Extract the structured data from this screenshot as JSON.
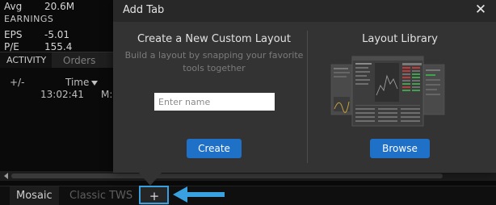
{
  "background": {
    "stats": [
      {
        "key": "Avg",
        "value": "20.6M"
      },
      {
        "key": "EPS",
        "value": "-5.01"
      },
      {
        "key": "P/E",
        "value": "155.4"
      }
    ],
    "stats_sub": "EARNINGS",
    "tabs": {
      "active": "ACTIVITY",
      "orders": "Orders"
    },
    "table": {
      "col_change": "+/-",
      "col_time": "Time",
      "row_time": "13:02:41",
      "row_extra": "M:"
    }
  },
  "bottom_tabs": {
    "mosaic": "Mosaic",
    "classic": "Classic TWS",
    "add": "+"
  },
  "dialog": {
    "title": "Add Tab",
    "close_glyph": "✕",
    "create": {
      "title": "Create a New Custom Layout",
      "description": "Build a layout by snapping your favorite tools together",
      "input_placeholder": "Enter name",
      "button_label": "Create"
    },
    "library": {
      "title": "Layout Library",
      "button_label": "Browse"
    }
  },
  "colors": {
    "accent": "#1f70c7",
    "highlight": "#3aa1e0",
    "dialog_bg": "#333333",
    "header_bg": "#282828"
  },
  "icons": [
    "close-icon",
    "sort-down-icon",
    "scroll-left-icon",
    "plus-icon",
    "arrow-left-icon"
  ]
}
